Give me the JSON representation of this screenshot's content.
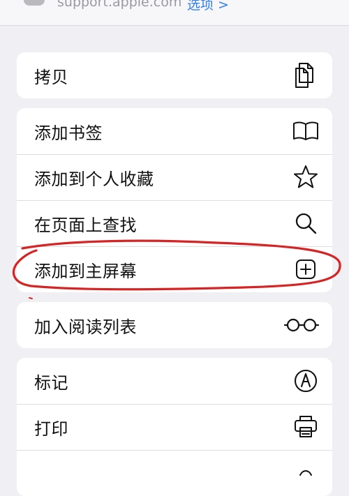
{
  "top_bar": {
    "url_text": "support.apple.com",
    "options_text": "选项 >"
  },
  "menu": {
    "group1": {
      "copy_label": "拷贝"
    },
    "group2": {
      "add_bookmark_label": "添加书签",
      "add_favorites_label": "添加到个人收藏",
      "find_on_page_label": "在页面上查找",
      "add_home_screen_label": "添加到主屏幕"
    },
    "group3": {
      "reading_list_label": "加入阅读列表"
    },
    "group4": {
      "markup_label": "标记",
      "print_label": "打印"
    }
  },
  "icons": {
    "copy": "copy-icon",
    "bookmark": "book-icon",
    "favorites": "star-icon",
    "find": "search-icon",
    "home_screen": "plus-square-icon",
    "reading_list": "glasses-icon",
    "markup": "markup-icon",
    "print": "printer-icon"
  },
  "colors": {
    "accent": "#2f7df6",
    "annotation": "#d62323"
  }
}
